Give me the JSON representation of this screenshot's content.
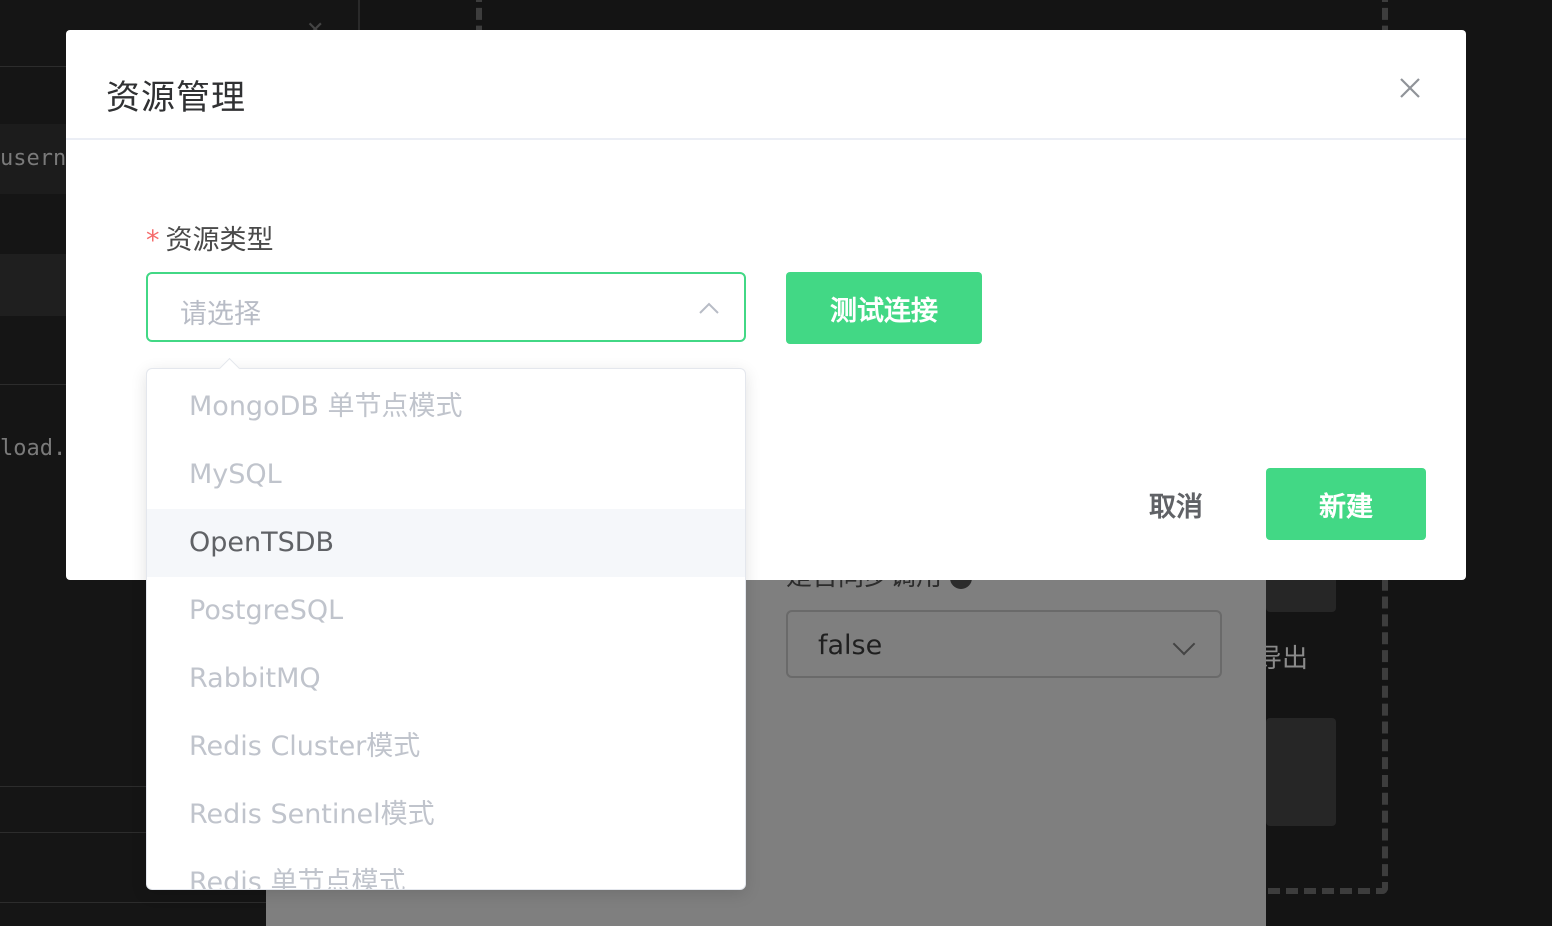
{
  "background": {
    "code_line_1": "usern",
    "code_line_2": "load.",
    "sync_label": "是否同步调用",
    "sync_select_value": "false",
    "export_label": "导出"
  },
  "modal": {
    "title": "资源管理",
    "form": {
      "required_mark": "*",
      "resource_type_label": "资源类型",
      "select_placeholder": "请选择",
      "test_connection_label": "测试连接"
    },
    "footer": {
      "cancel_label": "取消",
      "create_label": "新建"
    }
  },
  "dropdown": {
    "hovered_index": 2,
    "options": [
      "MongoDB 单节点模式",
      "MySQL",
      "OpenTSDB",
      "PostgreSQL",
      "RabbitMQ",
      "Redis Cluster模式",
      "Redis Sentinel模式",
      "Redis 单节点模式"
    ]
  },
  "colors": {
    "accent": "#42d885",
    "required": "#f56c6c",
    "placeholder": "#b8bcc6"
  }
}
